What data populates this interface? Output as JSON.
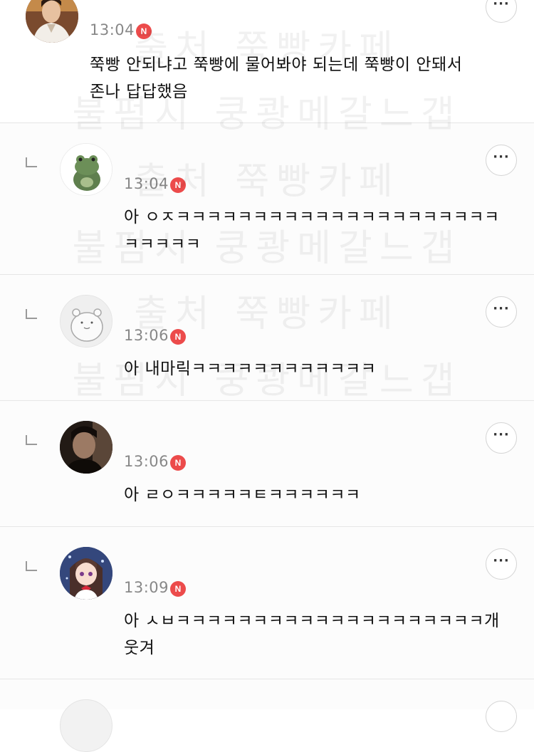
{
  "watermark": {
    "line1": "출처 쭉빵카페",
    "line2": "불펌시 쿵쾅메갈느갭"
  },
  "comments": [
    {
      "time": "13:04",
      "badge": "N",
      "text": "쭉빵 안되냐고 쭉빵에 물어봐야 되는데 쭉빵이 안돼서\n존나 답답했음",
      "more": "···"
    },
    {
      "time": "13:04",
      "badge": "N",
      "text": "아 ㅇㅈㅋㅋㅋㅋㅋㅋㅋㅋㅋㅋㅋㅋㅋㅋㅋㅋㅋㅋㅋㅋㅋ\nㅋㅋㅋㅋㅋ",
      "more": "···"
    },
    {
      "time": "13:06",
      "badge": "N",
      "text": "아 내마릭ㅋㅋㅋㅋㅋㅋㅋㅋㅋㅋㅋㅋ",
      "more": "···"
    },
    {
      "time": "13:06",
      "badge": "N",
      "text": "아 ㄹㅇㅋㅋㅋㅋㅋㅌㅋㅋㅋㅋㅋㅋ",
      "more": "···"
    },
    {
      "time": "13:09",
      "badge": "N",
      "text": "아 ㅅㅂㅋㅋㅋㅋㅋㅋㅋㅋㅋㅋㅋㅋㅋㅋㅋㅋㅋㅋㅋㅋ개\n웃겨",
      "more": "···"
    }
  ],
  "avatars": [
    "man-portrait-avatar",
    "frog-plush-avatar",
    "hamster-doodle-avatar",
    "dark-photo-avatar",
    "anime-girl-avatar"
  ]
}
